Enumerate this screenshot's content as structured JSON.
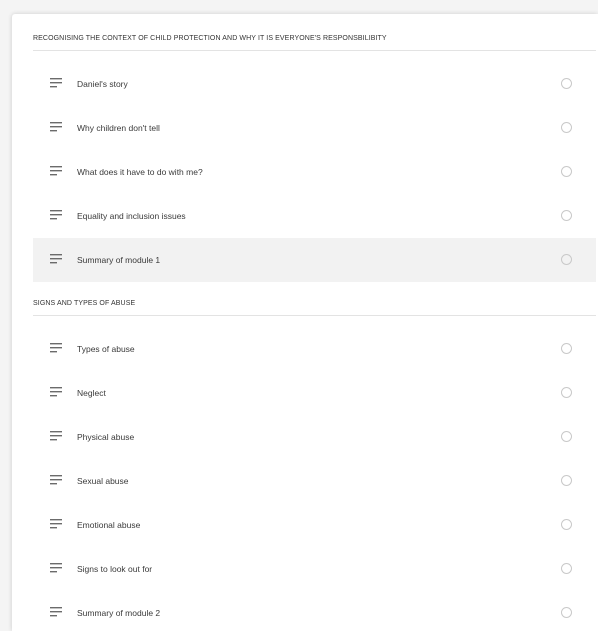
{
  "sections": [
    {
      "title": "RECOGNISING THE CONTEXT OF CHILD PROTECTION AND WHY IT IS EVERYONE'S RESPONSBILIBITY",
      "lessons": [
        {
          "label": "Daniel's story"
        },
        {
          "label": "Why children don't tell"
        },
        {
          "label": "What does it have to do with me?"
        },
        {
          "label": "Equality and inclusion issues"
        },
        {
          "label": "Summary of module 1"
        }
      ]
    },
    {
      "title": "SIGNS AND TYPES OF ABUSE",
      "lessons": [
        {
          "label": "Types of abuse"
        },
        {
          "label": "Neglect"
        },
        {
          "label": "Physical abuse"
        },
        {
          "label": "Sexual abuse"
        },
        {
          "label": "Emotional abuse"
        },
        {
          "label": "Signs to look out for"
        },
        {
          "label": "Summary of module 2"
        }
      ]
    }
  ],
  "active_lesson": "Summary of module 1",
  "colors": {
    "icon": "#6b6b6b",
    "text": "#3a3a3a",
    "divider": "#e3e3e3",
    "active_row": "#f2f2f2",
    "status_circle": "#c9c9c9"
  },
  "icons": {
    "lesson_type": "text-lines-icon",
    "status": "incomplete-circle-icon"
  }
}
